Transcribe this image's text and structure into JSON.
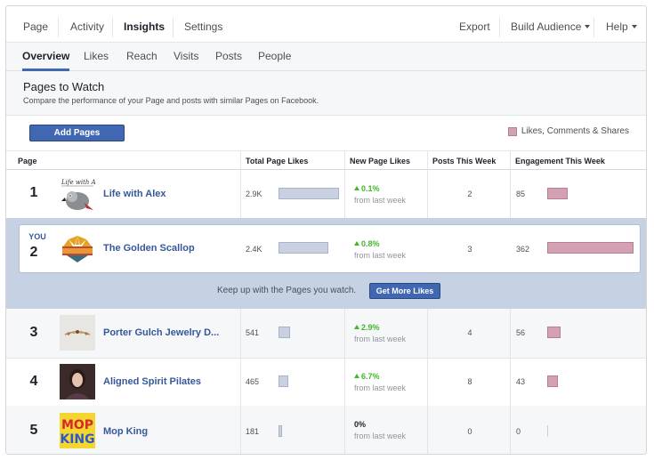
{
  "nav": {
    "tabs": [
      "Page",
      "Activity",
      "Insights",
      "Settings"
    ],
    "active": "Insights",
    "export": "Export",
    "build_audience": "Build Audience",
    "help": "Help"
  },
  "subnav": {
    "tabs": [
      "Overview",
      "Likes",
      "Reach",
      "Visits",
      "Posts",
      "People"
    ],
    "active": "Overview"
  },
  "header": {
    "title": "Pages to Watch",
    "subtitle": "Compare the performance of your Page and posts with similar Pages on Facebook."
  },
  "actions": {
    "add_pages": "Add Pages",
    "legend": "Likes, Comments & Shares"
  },
  "table": {
    "columns": [
      "Page",
      "Total Page Likes",
      "New Page Likes",
      "Posts This Week",
      "Engagement This Week"
    ],
    "rows": [
      {
        "rank": "1",
        "name": "Life with Alex",
        "likes": "2.9K",
        "new_pct": "0.1%",
        "new_sub": "from last week",
        "posts": "2",
        "engagement": "85",
        "likes_bar": 2900,
        "eng_bar": 85
      },
      {
        "rank": "2",
        "you": "YOU",
        "name": "The Golden Scallop",
        "likes": "2.4K",
        "new_pct": "0.8%",
        "new_sub": "from last week",
        "posts": "3",
        "engagement": "362",
        "likes_bar": 2400,
        "eng_bar": 362
      },
      {
        "rank": "3",
        "name": "Porter Gulch Jewelry D...",
        "likes": "541",
        "new_pct": "2.9%",
        "new_sub": "from last week",
        "posts": "4",
        "engagement": "56",
        "likes_bar": 541,
        "eng_bar": 56
      },
      {
        "rank": "4",
        "name": "Aligned Spirit Pilates",
        "likes": "465",
        "new_pct": "6.7%",
        "new_sub": "from last week",
        "posts": "8",
        "engagement": "43",
        "likes_bar": 465,
        "eng_bar": 43
      },
      {
        "rank": "5",
        "name": "Mop King",
        "likes": "181",
        "new_pct": "0%",
        "new_sub": "from last week",
        "posts": "0",
        "engagement": "0",
        "likes_bar": 181,
        "eng_bar": 0
      }
    ]
  },
  "promo": {
    "message": "Keep up with the Pages you watch.",
    "button": "Get More Likes"
  },
  "thumbs": {
    "alex_logo_text": "Life with Alex",
    "mop_logo_line1": "MOP",
    "mop_logo_line2": "KING"
  },
  "colors": {
    "accent": "#4267b2",
    "link": "#365899",
    "growth": "#42b72a",
    "likes_bar": "#c9d1e1",
    "engagement_bar": "#d3a0b4"
  }
}
